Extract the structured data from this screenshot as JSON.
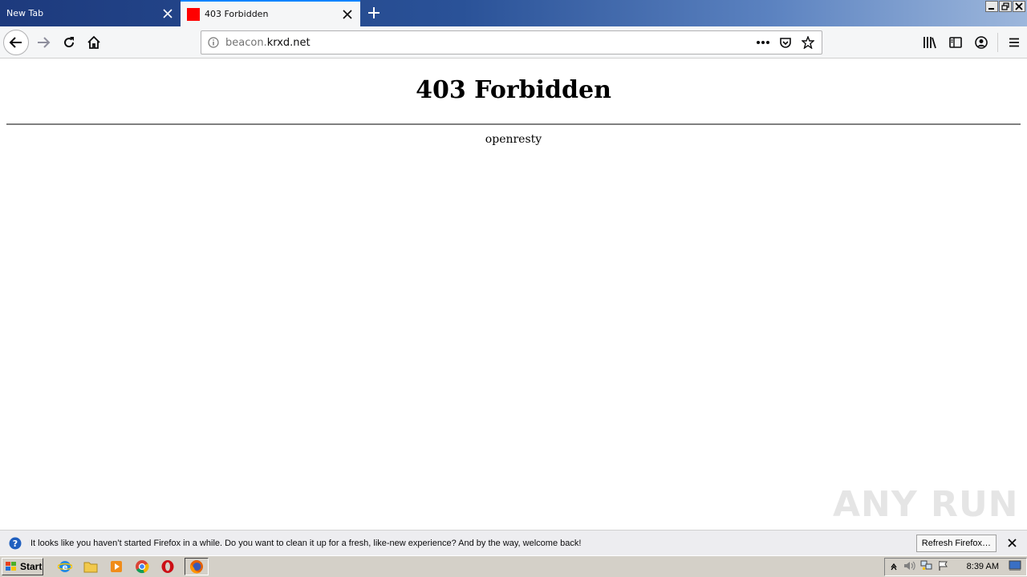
{
  "tabs": [
    {
      "title": "New Tab",
      "active": false
    },
    {
      "title": "403 Forbidden",
      "active": true
    }
  ],
  "urlbar": {
    "url_dim": "beacon.",
    "url_main": "krxd.net"
  },
  "page": {
    "heading": "403 Forbidden",
    "server": "openresty"
  },
  "notification": {
    "text": "It looks like you haven’t started Firefox in a while. Do you want to clean it up for a fresh, like-new experience? And by the way, welcome back!",
    "button_label": "Refresh Firefox…"
  },
  "watermark": "ANY RUN",
  "taskbar": {
    "start_label": "Start",
    "clock": "8:39 AM"
  },
  "colors": {
    "tab_accent": "#0a84ff",
    "favicon": "#ff0000"
  }
}
